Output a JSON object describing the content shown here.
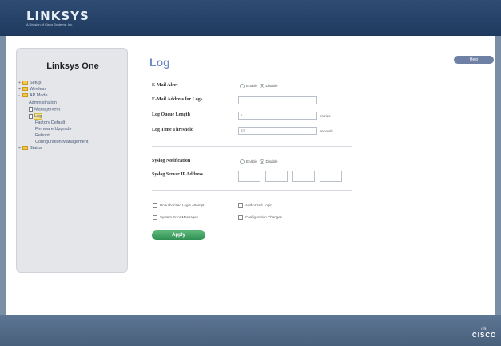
{
  "brand": {
    "logo": "LINKSYS",
    "tagline": "A Division of Cisco Systems, Inc."
  },
  "sidebar": {
    "title": "Linksys One",
    "items": [
      {
        "label": "Setup",
        "kind": "folder"
      },
      {
        "label": "Wireless",
        "kind": "folder"
      },
      {
        "label": "AP Mode",
        "kind": "folder"
      },
      {
        "label": "Administration",
        "kind": "text"
      },
      {
        "label": "Management",
        "kind": "page"
      },
      {
        "label": "Log",
        "kind": "page"
      },
      {
        "label": "Factory Default",
        "kind": "text"
      },
      {
        "label": "Firmware Upgrade",
        "kind": "text"
      },
      {
        "label": "Reboot",
        "kind": "text"
      },
      {
        "label": "Configuration Management",
        "kind": "text"
      },
      {
        "label": "Status",
        "kind": "folder"
      }
    ]
  },
  "main": {
    "title": "Log",
    "help_label": "Help",
    "email_alert": {
      "label": "E-Mail Alert",
      "enable": "Enable",
      "disable": "Disable",
      "selected": "Disable"
    },
    "email_address": {
      "label": "E-Mail Address for Logs",
      "value": ""
    },
    "queue_length": {
      "label": "Log Queue Length",
      "value": "1",
      "unit": "entries"
    },
    "time_threshold": {
      "label": "Log Time Threshold",
      "value": "10",
      "unit": "seconds"
    },
    "syslog_notification": {
      "label": "Syslog Notification",
      "enable": "Enable",
      "disable": "Disable",
      "selected": "Disable"
    },
    "syslog_server": {
      "label": "Syslog Server IP Address",
      "octets": [
        "",
        "",
        "",
        ""
      ]
    },
    "checkboxes": [
      "Unauthorized Login Attempt",
      "Authorized Login",
      "System Error Messages",
      "Configuration Changes"
    ],
    "apply_label": "Apply"
  },
  "footer": {
    "brand": "CISCO"
  },
  "colors": {
    "header": "#1f3a5e",
    "accent_title": "#6d8cc4",
    "apply": "#2f8f52",
    "help": "#6f80a5"
  }
}
